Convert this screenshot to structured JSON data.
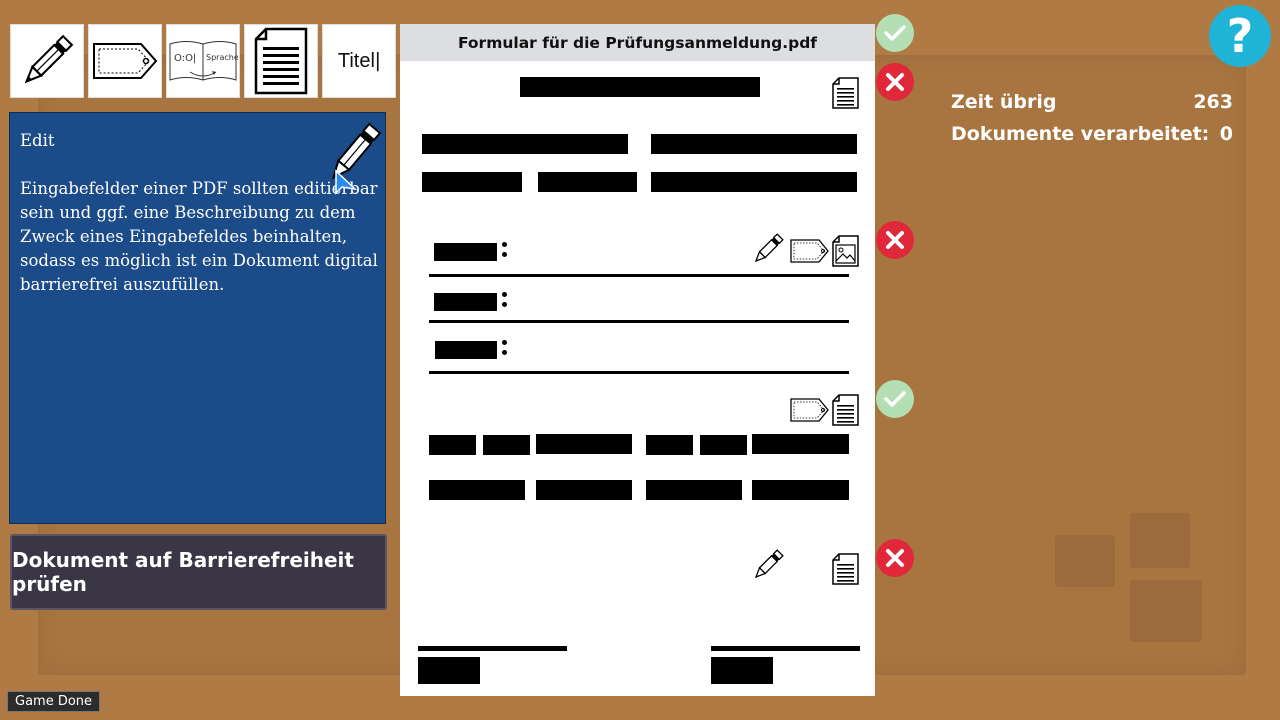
{
  "document": {
    "title": "Formular für die Prüfungsanmeldung.pdf"
  },
  "info_panel": {
    "title": "Edit",
    "body": "Eingabefelder einer PDF sollten editierbar sein und ggf. eine Beschreibung zu dem Zweck eines Eingabefeldes beinhalten, sodass es möglich ist ein Dokument digital barrierefrei auszufüllen."
  },
  "toolbar": {
    "tools": [
      "pencil-icon",
      "tag-icon",
      "language-icon",
      "document-icon",
      "title-icon"
    ],
    "language_label": "Sprache",
    "title_label": "Titel"
  },
  "check_button_label": "Dokument auf Barrierefreiheit prüfen",
  "game_done_label": "Game Done",
  "help_label": "?",
  "stats": {
    "time_label": "Zeit übrig",
    "time_value": "263",
    "processed_label": "Dokumente verarbeitet:",
    "processed_value": "0"
  },
  "section_status": [
    "correct",
    "incorrect",
    "incorrect",
    "correct",
    "incorrect"
  ],
  "colors": {
    "panel_blue": "#1b4b88",
    "button_dark": "#3a3645",
    "desk_brown": "#b07a45",
    "ok_green": "#b4dfb4",
    "error_red": "#e0283a",
    "help_cyan": "#1fb3d6"
  }
}
